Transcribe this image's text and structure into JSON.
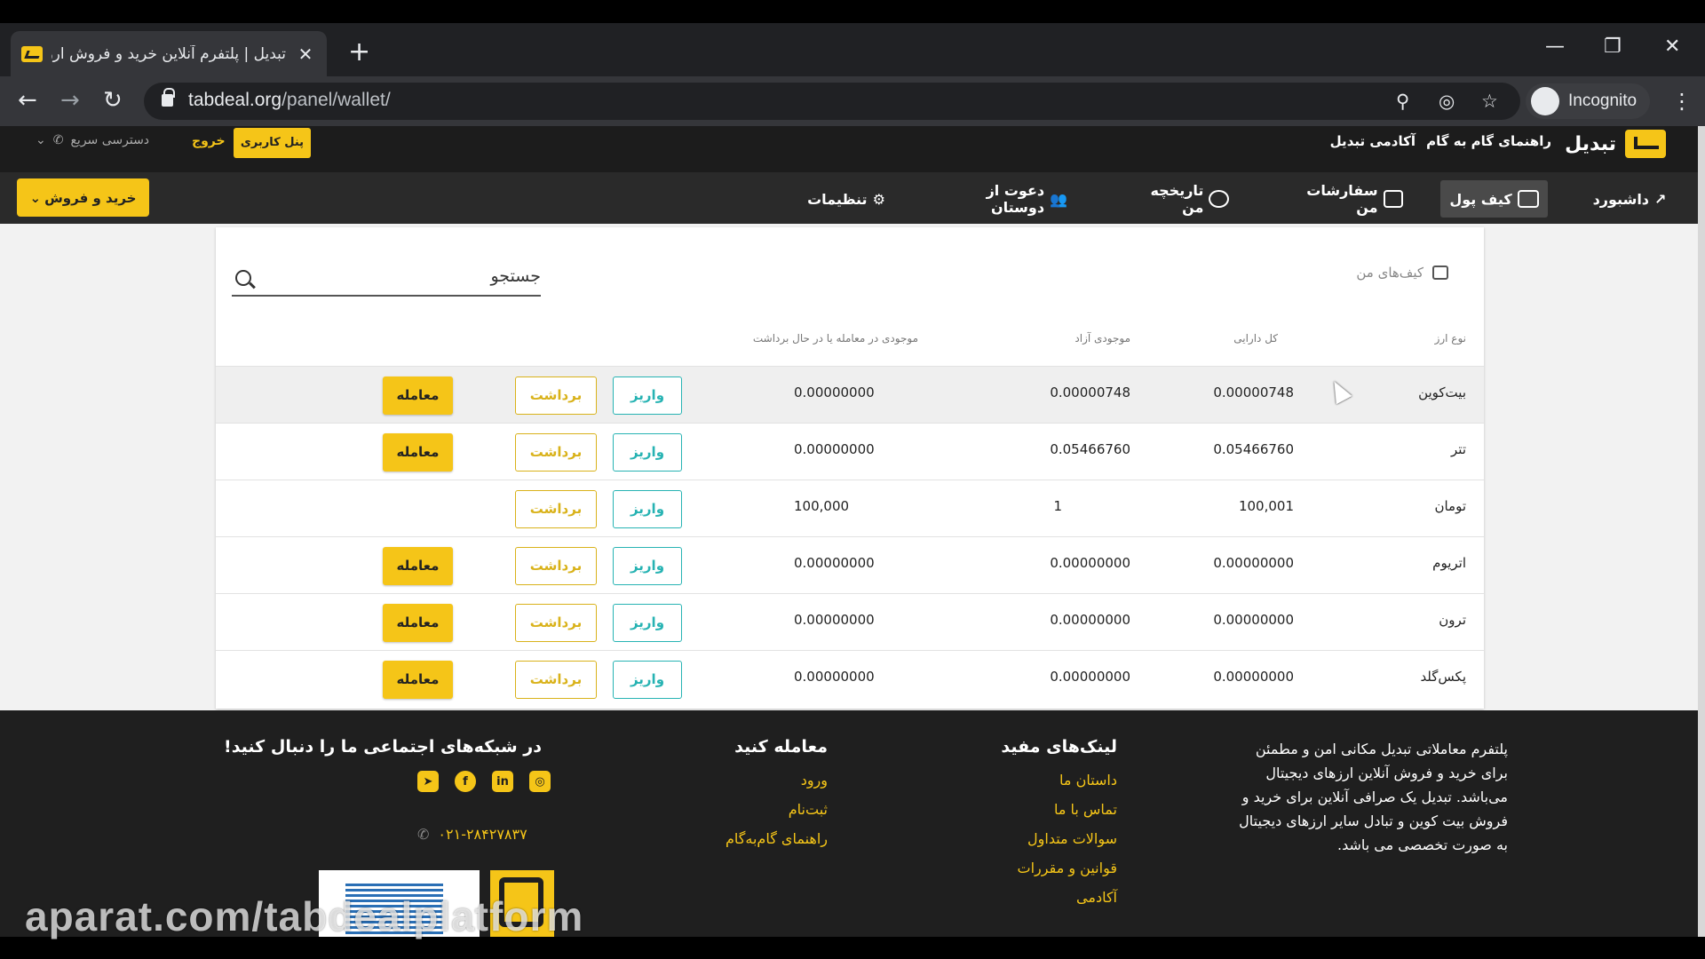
{
  "browser": {
    "tab_title": "تبدیل | پلتفرم آنلاین خرید و فروش ارز",
    "url_host": "tabdeal.org",
    "url_path": "/panel/wallet/",
    "profile_label": "Incognito"
  },
  "site_header": {
    "logo_text": "تبدیل",
    "links": [
      "راهنمای گام به گام",
      "آکادمی تبدیل"
    ],
    "panel_button": "پنل کاربری",
    "logout": "خروج",
    "quick_access": "دسترسی سریع"
  },
  "nav": {
    "items": [
      "داشبورد",
      "کیف پول",
      "سفارشات من",
      "تاریخچه من",
      "دعوت از دوستان",
      "تنظیمات"
    ],
    "active": "کیف پول",
    "buy_sell": "خرید و فروش"
  },
  "wallets": {
    "title": "کیف‌های من",
    "search_placeholder": "جستجو",
    "columns": [
      "نوع ارز",
      "کل دارایی",
      "موجودی آزاد",
      "موجودی در معامله یا در حال برداشت"
    ],
    "deposit_label": "واریز",
    "withdraw_label": "برداشت",
    "trade_label": "معامله",
    "rows": [
      {
        "currency": "بیت‌کوین",
        "total": "0.00000748",
        "free": "0.00000748",
        "locked": "0.00000000"
      },
      {
        "currency": "تتر",
        "total": "0.05466760",
        "free": "0.05466760",
        "locked": "0.00000000"
      },
      {
        "currency": "تومان",
        "total": "100,001",
        "free": "1",
        "locked": "100,000"
      },
      {
        "currency": "اتریوم",
        "total": "0.00000000",
        "free": "0.00000000",
        "locked": "0.00000000"
      },
      {
        "currency": "ترون",
        "total": "0.00000000",
        "free": "0.00000000",
        "locked": "0.00000000"
      },
      {
        "currency": "پکس‌گلد",
        "total": "0.00000000",
        "free": "0.00000000",
        "locked": "0.00000000"
      }
    ]
  },
  "footer": {
    "about": "پلتفرم معاملاتی تبدیل مکانی امن و مطمئن برای خرید و فروش آنلاین ارزهای دیجیتال می‌باشد. تبدیل یک صرافی آنلاین برای خرید و فروش بیت کوین و تبادل سایر ارزهای دیجیتال به صورت تخصصی می باشد.",
    "useful_links_title": "لینک‌های مفید",
    "useful_links": [
      "داستان ما",
      "تماس با ما",
      "سوالات متداول",
      "قوانین و مقررات",
      "آکادمی"
    ],
    "trade_title": "معامله کنید",
    "trade_links": [
      "ورود",
      "ثبت‌نام",
      "راهنمای گام‌به‌گام"
    ],
    "social_title": "در شبکه‌های اجتماعی ما را دنبال کنید!",
    "phone": "۰۲۱-۲۸۴۲۷۸۳۷"
  },
  "watermark": "aparat.com/tabdealplatform"
}
